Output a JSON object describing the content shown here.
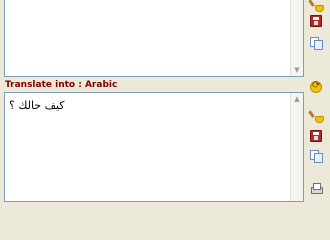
{
  "target_label": "Translate into : Arabic",
  "translated_text": "كيف حالك ؟",
  "toolbar_top": [
    {
      "icon": "clear-icon"
    },
    {
      "icon": "save-icon"
    },
    {
      "icon": "copy-icon"
    }
  ],
  "toolbar_middle": [
    {
      "icon": "swap-icon"
    }
  ],
  "toolbar_bottom": [
    {
      "icon": "clear-icon"
    },
    {
      "icon": "save-icon"
    },
    {
      "icon": "copy-icon"
    },
    {
      "icon": "print-icon"
    }
  ]
}
